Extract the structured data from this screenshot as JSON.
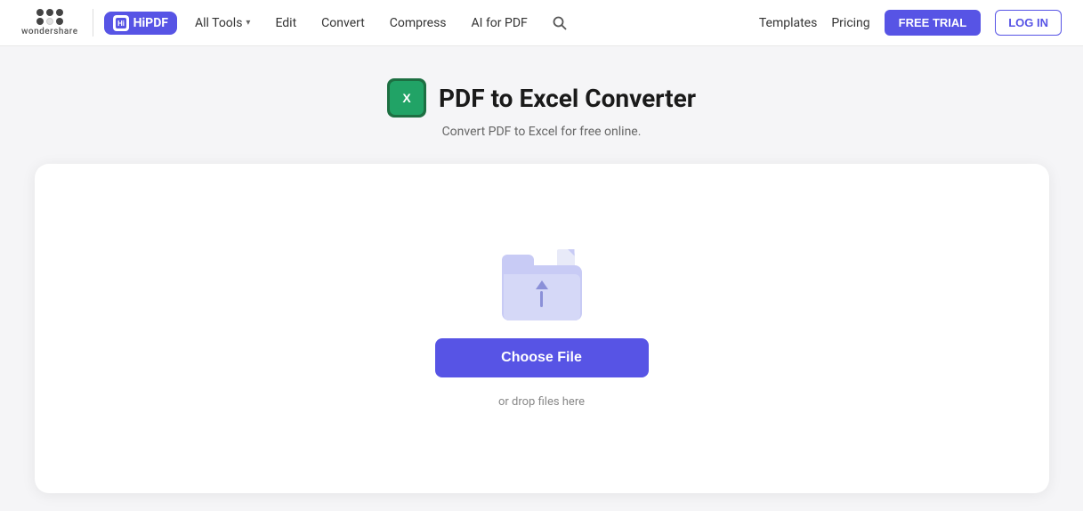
{
  "brand": {
    "wondershare_text": "wondershare",
    "hipdf_label": "HiPDF",
    "hipdf_icon_text": "Hi"
  },
  "navbar": {
    "all_tools_label": "All Tools",
    "edit_label": "Edit",
    "convert_label": "Convert",
    "compress_label": "Compress",
    "ai_label": "AI for PDF",
    "templates_label": "Templates",
    "pricing_label": "Pricing",
    "free_trial_label": "FREE TRIAL",
    "login_label": "LOG IN"
  },
  "page": {
    "title": "PDF to Excel Converter",
    "subtitle": "Convert PDF to Excel for free online.",
    "choose_file_label": "Choose File",
    "drop_hint": "or drop files here"
  },
  "colors": {
    "brand_purple": "#5754e5",
    "excel_green": "#21a366"
  }
}
